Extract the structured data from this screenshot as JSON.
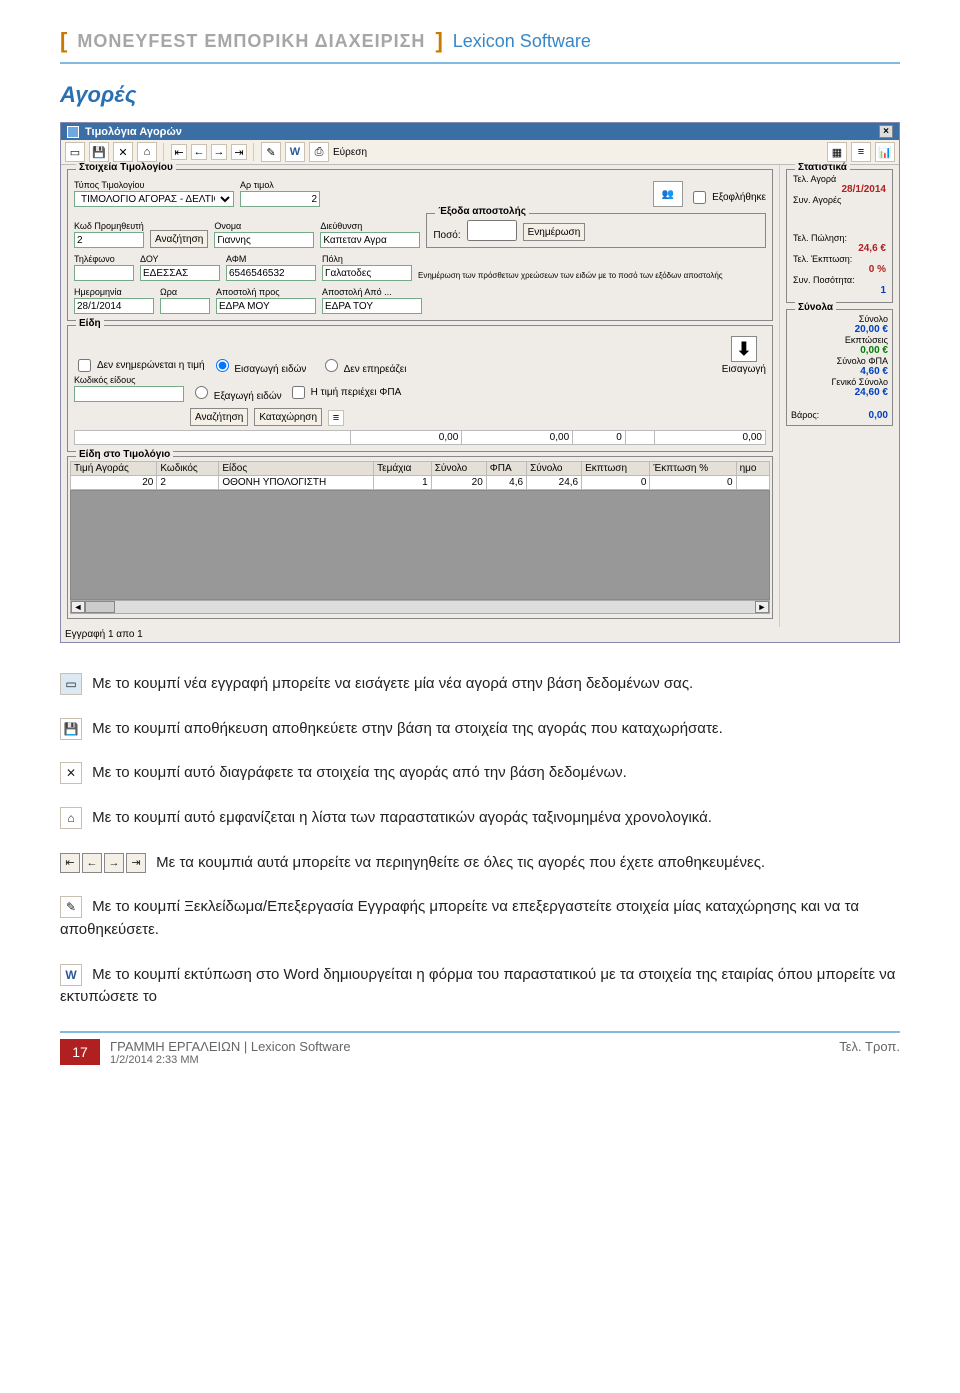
{
  "header": {
    "bracket_open": "[",
    "title1": "MONEYFEST ΕΜΠΟΡΙΚΗ ΔΙΑΧΕΙΡΙΣΗ",
    "bracket_close": "]",
    "title2": "Lexicon Software"
  },
  "section_title": "Αγορές",
  "window": {
    "title": "Τιμολόγια Αγορών",
    "close_glyph": "×",
    "toolbar": {
      "find_label": "Εύρεση"
    },
    "groups": {
      "invoice": {
        "title": "Στοιχεία Τιμολογίου",
        "type_label": "Τύπος Τιμολογίου",
        "type_value": "ΤΙΜΟΛΟΓΙΟ ΑΓΟΡΑΣ - ΔΕΛΤΙΟ",
        "number_label": "Αρ τιμολ",
        "number_value": "2",
        "supplier_code_label": "Κωδ Προμηθευτή",
        "supplier_code_value": "2",
        "search_btn": "Αναζήτηση",
        "name_label": "Ονομα",
        "name_value": "Γιαννης",
        "address_label": "Διεύθυνση",
        "address_value": "Καπεταν Αγρα",
        "phone_label": "Τηλέφωνο",
        "phone_value": "",
        "doy_label": "ΔΟΥ",
        "doy_value": "ΕΔΕΣΣΑΣ",
        "afm_label": "ΑΦΜ",
        "afm_value": "6546546532",
        "city_label": "Πόλη",
        "city_value": "Γαλατοδες",
        "date_label": "Ημερομηνία",
        "date_value": "28/1/2014",
        "time_label": "Ωρα",
        "time_value": "",
        "shipto_label": "Αποστολή προς",
        "shipto_value": "ΕΔΡΑ ΜΟΥ",
        "shipfrom_label": "Αποστολή Από ...",
        "shipfrom_value": "ΕΔΡΑ ΤΟΥ",
        "ex_checkbox_label": "Εξοφλήθηκε"
      },
      "shipping": {
        "title": "Έξοδα αποστολής",
        "amount_label": "Ποσό:",
        "amount_value": "",
        "update_btn": "Ενημέρωση",
        "note": "Ενημέρωση των πρόσθετων χρεώσεων των ειδών με το ποσό των εξόδων αποστολής"
      },
      "items": {
        "title": "Είδη",
        "no_update_checkbox": "Δεν ενημερώνεται η τιμή",
        "radio_import": "Εισαγωγή ειδών",
        "radio_export": "Εξαγωγή ειδών",
        "radio_noaffect": "Δεν επηρεάζει",
        "price_vat_checkbox": "Η τιμή περιέχει ΦΠΑ",
        "item_code_label": "Κωδικός είδους",
        "item_code_value": "",
        "search_btn": "Αναζήτηση",
        "register_btn": "Καταχώρηση",
        "import_btn_label": "Εισαγωγή",
        "totals_cells": [
          "0,00",
          "0,00",
          "0",
          "0,00"
        ]
      },
      "lines": {
        "title": "Είδη στο Τιμολόγιο",
        "headers": [
          "Τιμή Αγοράς",
          "Κωδικός",
          "Είδος",
          "Τεμάχια",
          "Σύνολο",
          "ΦΠΑ",
          "Σύνολο",
          "Εκπτωση",
          "Έκπτωση %",
          "ημο"
        ],
        "row0": [
          "20",
          "2",
          "ΟΘΟΝΗ ΥΠΟΛΟΓΙΣΤΗ",
          "1",
          "20",
          "4,6",
          "24,6",
          "0",
          "0",
          ""
        ]
      }
    },
    "record_status": "Εγγραφή 1 απο 1",
    "stats": {
      "title": "Στατιστικά",
      "last_purchase_label": "Τελ. Αγορά",
      "last_purchase_value": "28/1/2014",
      "total_purchases_label": "Συν. Αγορές",
      "last_sale_label": "Τελ. Πώληση:",
      "last_sale_value": "24,6 €",
      "last_disc_label": "Τελ. Έκπτωση:",
      "last_disc_value": "0 %",
      "total_qty_label": "Συν. Ποσότητα:",
      "total_qty_value": "1"
    },
    "totals": {
      "title": "Σύνολα",
      "sum_label": "Σύνολο",
      "sum_value": "20,00 €",
      "disc_label": "Εκπτώσεις",
      "disc_value": "0,00 €",
      "vat_label": "Σύνολο ΦΠΑ",
      "vat_value": "4,60 €",
      "grand_label": "Γενικό Σύνολο",
      "grand_value": "24,60 €",
      "weight_label": "Βάρος:",
      "weight_value": "0,00"
    }
  },
  "paragraphs": {
    "p1": "Με το κουμπί νέα εγγραφή μπορείτε να εισάγετε μία νέα αγορά στην βάση δεδομένων σας.",
    "p2": "Με το κουμπί αποθήκευση αποθηκεύετε στην βάση τα στοιχεία της αγοράς που καταχωρήσατε.",
    "p3": "Με το κουμπί αυτό διαγράφετε τα στοιχεία της αγοράς από την βάση δεδομένων.",
    "p4": "Με το κουμπί αυτό εμφανίζεται η λίστα των παραστατικών αγοράς ταξινομημένα χρονολογικά.",
    "p5": "Με τα κουμπιά αυτά μπορείτε να περιηγηθείτε σε όλες τις αγορές που έχετε αποθηκευμένες.",
    "p6": "Με το κουμπί Ξεκλείδωμα/Επεξεργασία Εγγραφής μπορείτε να επεξεργαστείτε στοιχεία μίας καταχώρησης και να τα αποθηκεύσετε.",
    "p7": "Με το κουμπί εκτύπωση στο Word δημιουργείται η φόρμα του παραστατικού με τα στοιχεία της εταιρίας όπου μπορείτε να εκτυπώσετε το"
  },
  "footer": {
    "page_number": "17",
    "line1": "ΓΡΑΜΜΗ ΕΡΓΑΛΕΙΩΝ | Lexicon Software",
    "line2": "1/2/2014 2:33 ΜΜ",
    "right": "Τελ. Τροπ."
  }
}
